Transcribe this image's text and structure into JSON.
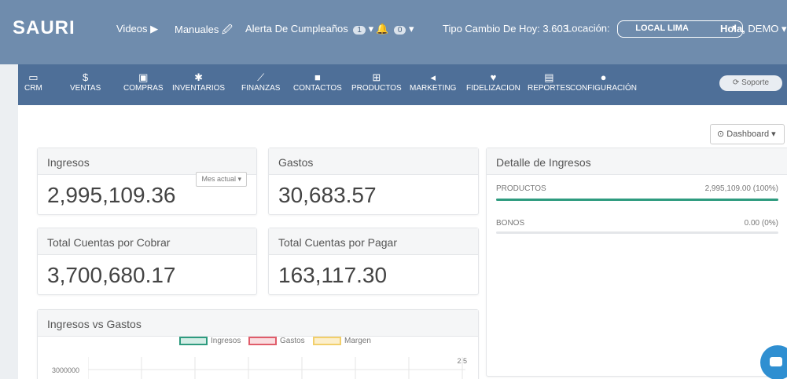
{
  "topbar": {
    "logo": "SAURI",
    "videos": "Videos ▶",
    "manuales": "Manuales 🖉",
    "alerta": "Alerta De Cumpleaños",
    "alerta_count": "1",
    "bell_count": "0",
    "tipo_cambio": "Tipo Cambio De Hoy: 3.603",
    "locacion_label": "Locación:",
    "locacion_value": "LOCAL LIMA",
    "hola": "Hola,",
    "user": "DEMO"
  },
  "modules": [
    {
      "label": "CRM",
      "icon": "monitor-icon"
    },
    {
      "label": "VENTAS",
      "icon": "dollar-icon"
    },
    {
      "label": "COMPRAS",
      "icon": "card-icon"
    },
    {
      "label": "INVENTARIOS",
      "icon": "cubes-icon"
    },
    {
      "label": "FINANZAS",
      "icon": "chart-icon"
    },
    {
      "label": "CONTACTOS",
      "icon": "contact-icon"
    },
    {
      "label": "PRODUCTOS",
      "icon": "cart-icon"
    },
    {
      "label": "MARKETING",
      "icon": "megaphone-icon"
    },
    {
      "label": "FIDELIZACION",
      "icon": "heart-icon"
    },
    {
      "label": "REPORTES",
      "icon": "report-icon"
    },
    {
      "label": "CONFIGURACIÓN",
      "icon": "gear-icon"
    }
  ],
  "soporte": "Soporte",
  "dashboard_btn": "Dashboard ▾",
  "cards": {
    "ingresos": {
      "title": "Ingresos",
      "value": "2,995,109.36",
      "mes": "Mes actual ▾"
    },
    "gastos": {
      "title": "Gastos",
      "value": "30,683.57"
    },
    "cobrar": {
      "title": "Total Cuentas por Cobrar",
      "value": "3,700,680.17"
    },
    "pagar": {
      "title": "Total Cuentas por Pagar",
      "value": "163,117.30"
    }
  },
  "detalle": {
    "title": "Detalle de Ingresos",
    "rows": [
      {
        "label": "PRODUCTOS",
        "value": "2,995,109.00 (100%)",
        "pct": 100
      },
      {
        "label": "BONOS",
        "value": "0.00 (0%)",
        "pct": 0
      }
    ]
  },
  "chart_data": {
    "type": "bar",
    "title": "Ingresos vs Gastos",
    "series": [
      {
        "name": "Ingresos",
        "color": "#2e9b7f",
        "values": []
      },
      {
        "name": "Gastos",
        "color": "#e05c6a",
        "values": []
      },
      {
        "name": "Margen",
        "color": "#f2cf6b",
        "values": []
      }
    ],
    "y_tick_left": "3000000",
    "y_tick_right": "2.5"
  },
  "colors": {
    "topbar": "#6f8cad",
    "modnav": "#4e6f98",
    "accent": "#2e9b7f"
  }
}
